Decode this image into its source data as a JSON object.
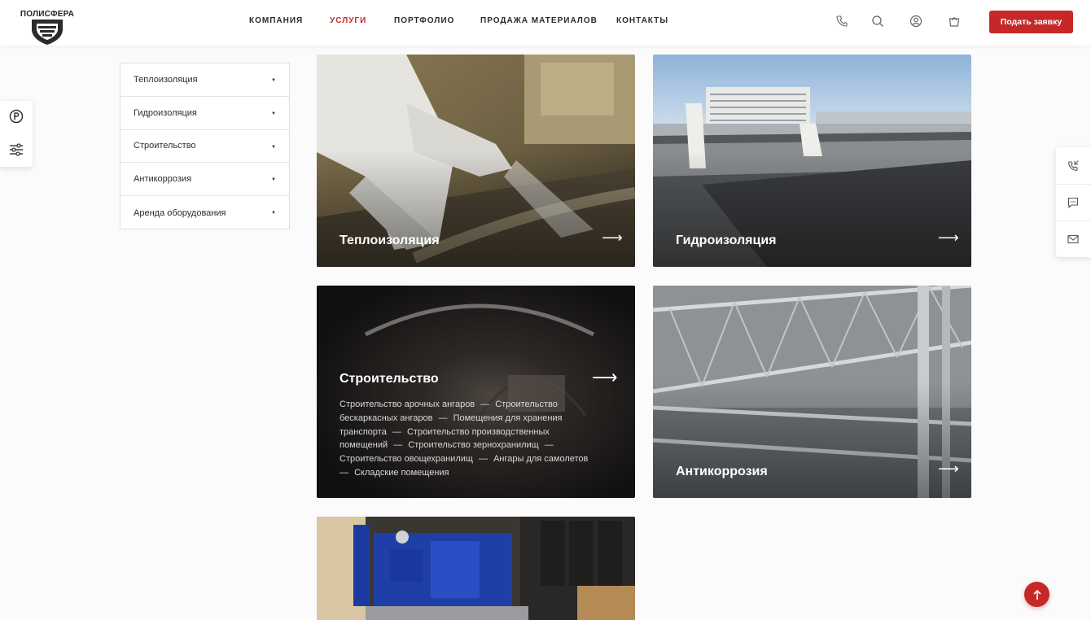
{
  "brand": {
    "name": "ПОЛИСФЕРА",
    "accent": "#c62828"
  },
  "nav": {
    "items": [
      {
        "label": "КОМПАНИЯ",
        "active": false
      },
      {
        "label": "УСЛУГИ",
        "active": true
      },
      {
        "label": "ПОРТФОЛИО",
        "active": false
      },
      {
        "label": "ПРОДАЖА МАТЕРИАЛОВ",
        "active": false
      },
      {
        "label": "КОНТАКТЫ",
        "active": false
      }
    ],
    "icons": [
      "phone-icon",
      "search-icon",
      "user-icon",
      "cart-icon"
    ],
    "cta_label": "Подать заявку"
  },
  "side_menu": {
    "items": [
      {
        "label": "Теплоизоляция"
      },
      {
        "label": "Гидроизоляция"
      },
      {
        "label": "Строительство"
      },
      {
        "label": "Антикоррозия"
      },
      {
        "label": "Аренда оборудования"
      }
    ]
  },
  "left_float_icons": [
    "currency-icon",
    "filter-sliders-icon"
  ],
  "right_float_icons": [
    "phone-callback-icon",
    "chat-icon",
    "mail-icon"
  ],
  "cards": [
    {
      "title": "Теплоизоляция",
      "arrow": "⟶"
    },
    {
      "title": "Гидроизоляция",
      "arrow": "⟶"
    },
    {
      "title": "Строительство",
      "arrow": "⟶",
      "links": [
        "Строительство арочных ангаров",
        "Строительство бескаркасных ангаров",
        "Помещения для хранения транспорта",
        "Строительство производственных помещений",
        "Строительство зернохранилищ",
        "Строительство овощехранилищ",
        "Ангары для самолетов",
        "Складские помещения"
      ],
      "separator": "—"
    },
    {
      "title": "Антикоррозия",
      "arrow": "⟶"
    },
    {
      "title": ""
    }
  ],
  "scroll_top_icon": "arrow-up-icon"
}
